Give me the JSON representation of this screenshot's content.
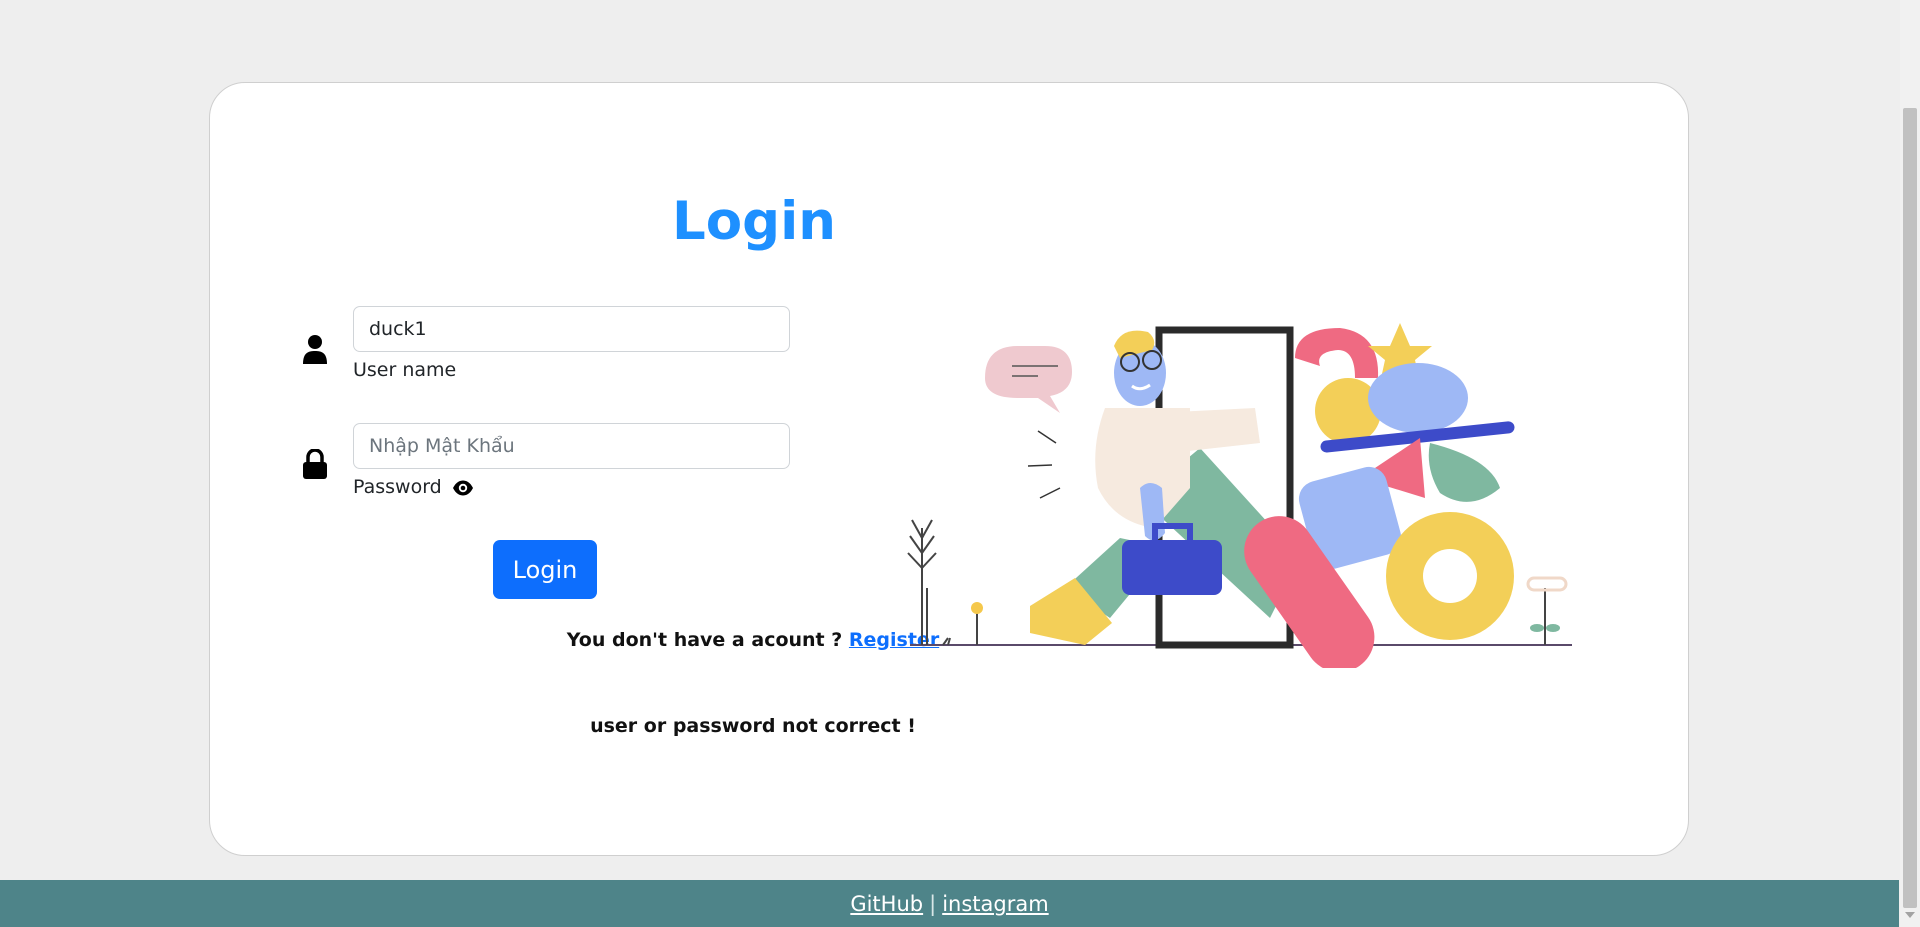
{
  "login_form": {
    "title": "Login",
    "username_value": "duck1",
    "username_label": "User name",
    "password_placeholder": "Nhập Mật Khẩu",
    "password_label": "Password",
    "login_button": "Login",
    "register_prompt": "You don't have a acount ?",
    "register_link": "Register",
    "error_message": "user or password not correct !"
  },
  "icons": {
    "username": "user-icon",
    "password": "lock-icon",
    "toggle_password": "eye-icon"
  },
  "illustration": {
    "description_icon": "person-walking-through-door-illustration"
  },
  "footer": {
    "github": "GitHub",
    "separator": "|",
    "instagram": "instagram"
  },
  "colors": {
    "title": "#1e90ff",
    "button": "#0d6efd",
    "footer": "#4e8489",
    "background": "#eeeeee"
  }
}
